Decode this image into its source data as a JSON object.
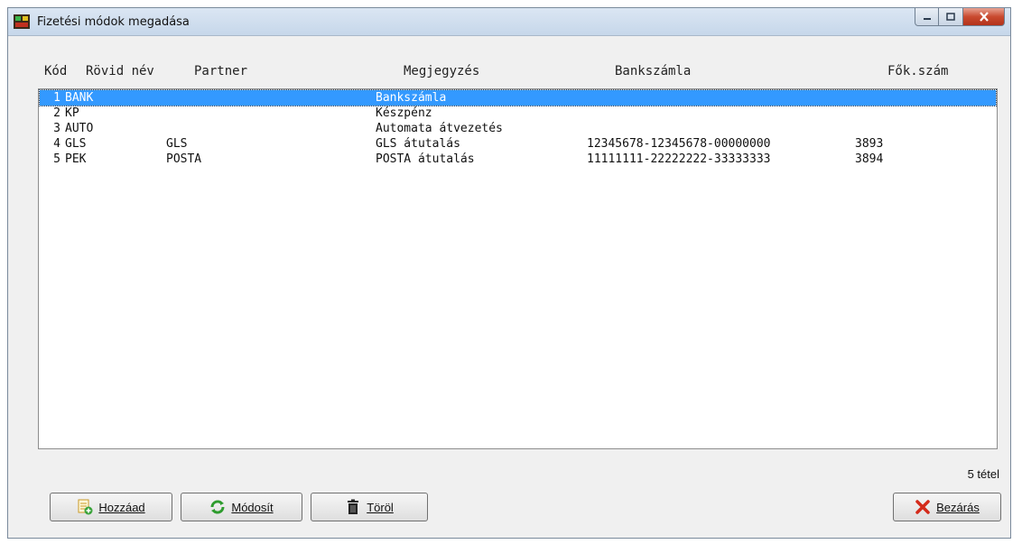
{
  "window": {
    "title": "Fizetési módok megadása"
  },
  "columns": {
    "kod": "Kód",
    "rovid_nev": "Rövid név",
    "partner": "Partner",
    "megjegyzes": "Megjegyzés",
    "bankszamla": "Bankszámla",
    "fok_szam": "Fők.szám"
  },
  "rows": [
    {
      "kod": "1",
      "rovid_nev": "BANK",
      "partner": "",
      "megjegyzes": "Bankszámla",
      "bankszamla": "",
      "fok_szam": "",
      "selected": true
    },
    {
      "kod": "2",
      "rovid_nev": "KP",
      "partner": "",
      "megjegyzes": "Készpénz",
      "bankszamla": "",
      "fok_szam": ""
    },
    {
      "kod": "3",
      "rovid_nev": "AUTO",
      "partner": "",
      "megjegyzes": "Automata átvezetés",
      "bankszamla": "",
      "fok_szam": ""
    },
    {
      "kod": "4",
      "rovid_nev": "GLS",
      "partner": "GLS",
      "megjegyzes": "GLS átutalás",
      "bankszamla": "12345678-12345678-00000000",
      "fok_szam": "3893"
    },
    {
      "kod": "5",
      "rovid_nev": "PEK",
      "partner": "POSTA",
      "megjegyzes": "POSTA átutalás",
      "bankszamla": "11111111-22222222-33333333",
      "fok_szam": "3894"
    }
  ],
  "footer": {
    "count": "5 tétel"
  },
  "buttons": {
    "add": {
      "label": "Hozzáad",
      "icon": "add-document-icon"
    },
    "modify": {
      "label": "Módosít",
      "icon": "refresh-icon"
    },
    "delete": {
      "label": "Töröl",
      "icon": "trash-icon"
    },
    "close": {
      "label": "Bezárás",
      "icon": "red-x-icon"
    }
  },
  "colors": {
    "selection": "#3399ff",
    "close_x": "#d42a1a"
  }
}
